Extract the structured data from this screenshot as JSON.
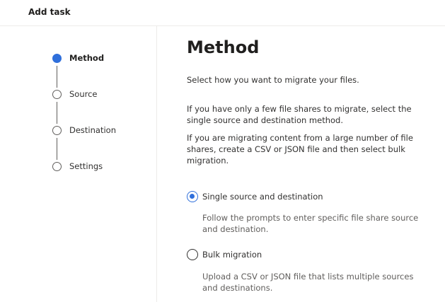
{
  "header": {
    "title": "Add task"
  },
  "steps": [
    {
      "label": "Method",
      "active": true
    },
    {
      "label": "Source",
      "active": false
    },
    {
      "label": "Destination",
      "active": false
    },
    {
      "label": "Settings",
      "active": false
    }
  ],
  "main": {
    "title": "Method",
    "intro": "Select how you want to migrate your files.",
    "para_single": "If you have only a few file shares to migrate, select the single source and destination method.",
    "para_bulk": "If you are migrating content from a large number of file shares, create a CSV or JSON file and then select bulk migration.",
    "options": [
      {
        "label": "Single source and destination",
        "description": "Follow the prompts to enter specific file share source and destination.",
        "selected": true
      },
      {
        "label": "Bulk migration",
        "description": "Upload a CSV or JSON file that lists multiple sources and destinations.",
        "selected": false
      }
    ]
  },
  "colors": {
    "accent": "#2f6fdb",
    "text": "#323130",
    "divider": "#edebe9"
  }
}
